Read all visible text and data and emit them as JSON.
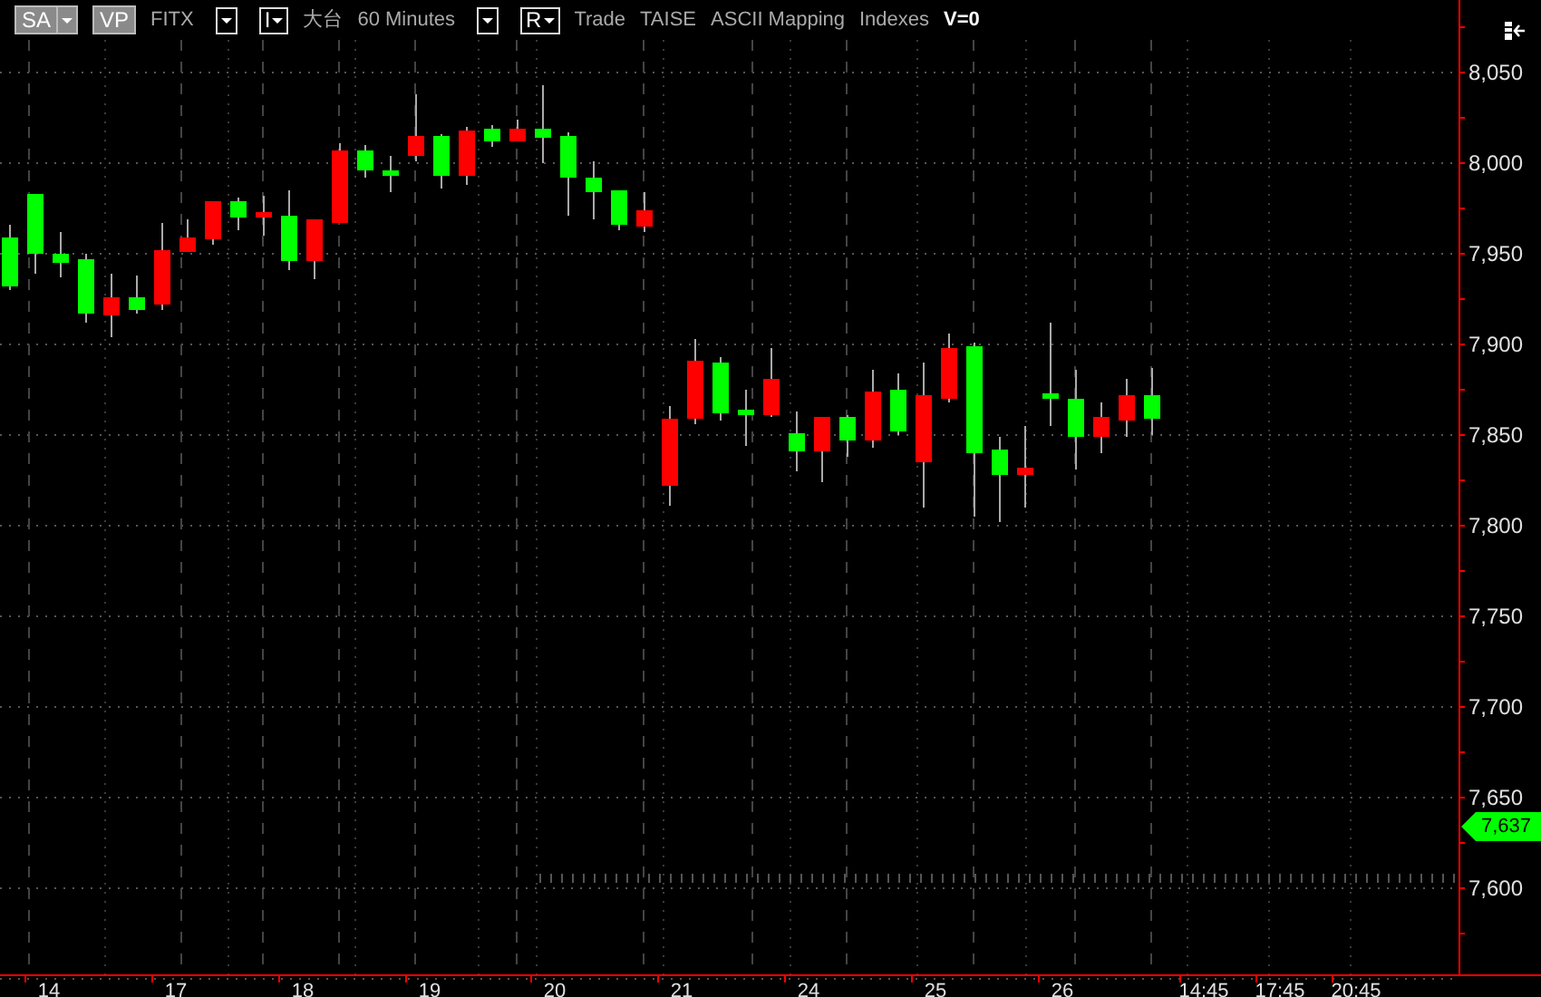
{
  "toolbar": [
    {
      "kind": "split",
      "label": "SA"
    },
    {
      "kind": "filled",
      "label": "VP"
    },
    {
      "kind": "text",
      "label": "FITX"
    },
    {
      "kind": "dropdown"
    },
    {
      "kind": "menu",
      "label": "I"
    },
    {
      "kind": "text",
      "label": "大台"
    },
    {
      "kind": "text",
      "label": "60 Minutes"
    },
    {
      "kind": "dropdown"
    },
    {
      "kind": "menu",
      "label": "R"
    },
    {
      "kind": "text",
      "label": "Trade"
    },
    {
      "kind": "text",
      "label": "TAISE"
    },
    {
      "kind": "text",
      "label": "ASCII Mapping"
    },
    {
      "kind": "text",
      "label": "Indexes"
    },
    {
      "kind": "value",
      "label": "V=0"
    }
  ],
  "price_axis": {
    "labels": [
      "8,050",
      "8,000",
      "7,950",
      "7,900",
      "7,850",
      "7,800",
      "7,750",
      "7,700",
      "7,650",
      "7,600"
    ]
  },
  "last_price": "7,637",
  "time_axis": {
    "labels": [
      "14",
      "17",
      "18",
      "19",
      "20",
      "21",
      "24",
      "25",
      "26",
      "14:45",
      "17:45",
      "20:45"
    ]
  }
}
